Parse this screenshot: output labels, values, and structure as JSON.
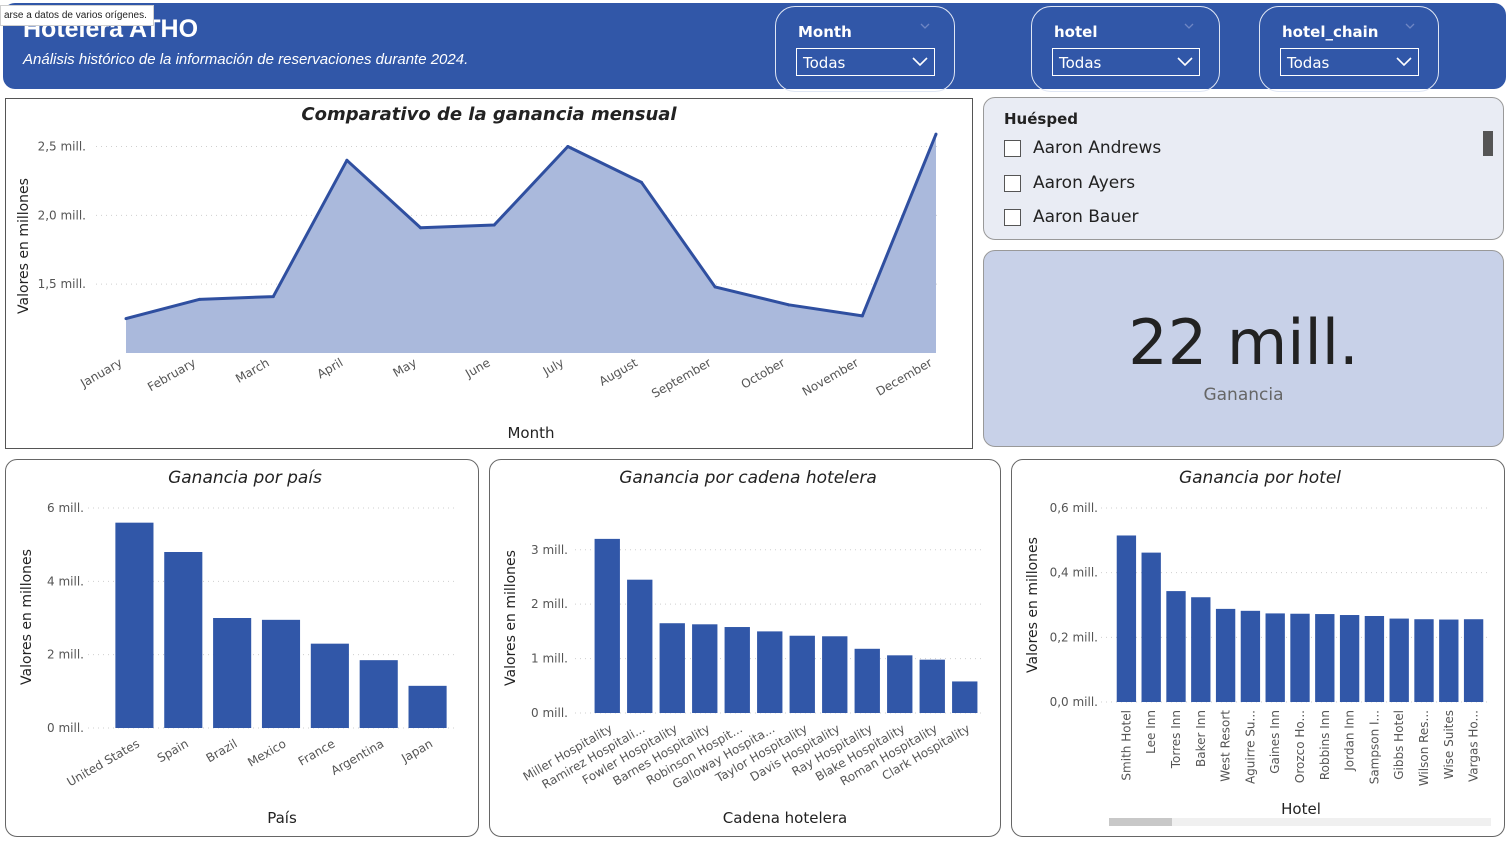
{
  "header": {
    "title": "Hotelera ATHO",
    "subtitle": "Análisis histórico de la información de reservaciones durante 2024.",
    "tooltip": "arse a datos de varios orígenes."
  },
  "filters": [
    {
      "label": "Month",
      "value": "Todas"
    },
    {
      "label": "hotel",
      "value": "Todas"
    },
    {
      "label": "hotel_chain",
      "value": "Todas"
    }
  ],
  "guest_slicer": {
    "title": "Huésped",
    "items": [
      "Aaron Andrews",
      "Aaron Ayers",
      "Aaron Bauer"
    ]
  },
  "kpi": {
    "value": "22 mill.",
    "label": "Ganancia"
  },
  "colors": {
    "bar": "#3157a8",
    "area_fill": "#aab9dc",
    "line": "#2f4fa0",
    "header": "#3157a8"
  },
  "chart_data": [
    {
      "type": "area",
      "title": "Comparativo de la ganancia mensual",
      "xlabel": "Month",
      "ylabel": "Valores en millones",
      "categories": [
        "January",
        "February",
        "March",
        "April",
        "May",
        "June",
        "July",
        "August",
        "September",
        "October",
        "November",
        "December"
      ],
      "values": [
        1.25,
        1.39,
        1.41,
        2.4,
        1.91,
        1.93,
        2.5,
        2.24,
        1.48,
        1.35,
        1.27,
        2.59
      ],
      "yticks": [
        {
          "v": 1.5,
          "label": "1,5 mill."
        },
        {
          "v": 2.0,
          "label": "2,0 mill."
        },
        {
          "v": 2.5,
          "label": "2,5 mill."
        }
      ],
      "grid": true
    },
    {
      "type": "bar",
      "title": "Ganancia por país",
      "xlabel": "País",
      "ylabel": "Valores en millones",
      "categories": [
        "United States",
        "Spain",
        "Brazil",
        "Mexico",
        "France",
        "Argentina",
        "Japan"
      ],
      "values": [
        5.6,
        4.8,
        3.0,
        2.95,
        2.3,
        1.85,
        1.15
      ],
      "ylim": [
        0,
        6
      ],
      "yticks": [
        {
          "v": 0,
          "label": "0 mill."
        },
        {
          "v": 2,
          "label": "2 mill."
        },
        {
          "v": 4,
          "label": "4 mill."
        },
        {
          "v": 6,
          "label": "6 mill."
        }
      ],
      "grid": true
    },
    {
      "type": "bar",
      "title": "Ganancia por cadena hotelera",
      "xlabel": "Cadena hotelera",
      "ylabel": "Valores en millones",
      "categories": [
        "Miller Hospitality",
        "Ramirez Hospitali...",
        "Fowler Hospitality",
        "Barnes Hospitality",
        "Robinson Hospit...",
        "Galloway Hospita...",
        "Taylor Hospitality",
        "Davis Hospitality",
        "Ray Hospitality",
        "Blake Hospitality",
        "Roman Hospitality",
        "Clark Hospitality"
      ],
      "values": [
        3.2,
        2.45,
        1.65,
        1.63,
        1.58,
        1.5,
        1.42,
        1.41,
        1.18,
        1.06,
        0.98,
        0.58
      ],
      "ylim": [
        0,
        3.4
      ],
      "yticks": [
        {
          "v": 0,
          "label": "0 mill."
        },
        {
          "v": 1,
          "label": "1 mill."
        },
        {
          "v": 2,
          "label": "2 mill."
        },
        {
          "v": 3,
          "label": "3 mill."
        }
      ],
      "grid": true
    },
    {
      "type": "bar",
      "title": "Ganancia por hotel",
      "xlabel": "Hotel",
      "ylabel": "Valores en millones",
      "categories": [
        "Smith Hotel",
        "Lee Inn",
        "Torres Inn",
        "Baker Inn",
        "West Resort",
        "Aguirre Su...",
        "Gaines Inn",
        "Orozco Ho...",
        "Robbins Inn",
        "Jordan Inn",
        "Sampson I...",
        "Gibbs Hotel",
        "Wilson Res...",
        "Wise Suites",
        "Vargas Ho..."
      ],
      "values": [
        0.515,
        0.462,
        0.343,
        0.324,
        0.288,
        0.282,
        0.274,
        0.273,
        0.272,
        0.269,
        0.266,
        0.258,
        0.256,
        0.255,
        0.256
      ],
      "ylim": [
        0,
        0.6
      ],
      "yticks": [
        {
          "v": 0,
          "label": "0,0 mill."
        },
        {
          "v": 0.2,
          "label": "0,2 mill."
        },
        {
          "v": 0.4,
          "label": "0,4 mill."
        },
        {
          "v": 0.6,
          "label": "0,6 mill."
        }
      ],
      "grid": true
    }
  ]
}
